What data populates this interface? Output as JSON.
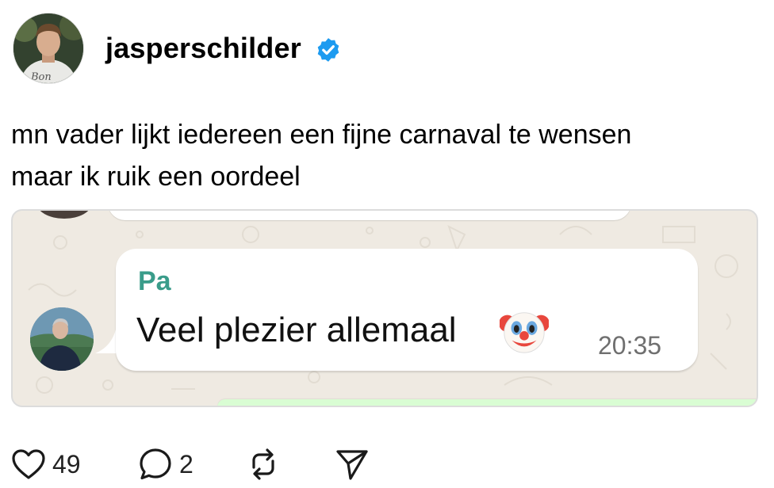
{
  "post": {
    "username": "jasperschilder",
    "verified": true,
    "text_lines": [
      "mn vader lijkt iedereen een fijne carnaval te wensen",
      "maar ik ruik een oordeel"
    ]
  },
  "embed": {
    "sender": "Pa",
    "message": "Veel plezier allemaal",
    "emoji": "clown-face",
    "time": "20:35"
  },
  "actions": {
    "likes": "49",
    "replies": "2"
  },
  "colors": {
    "verified": "#1d9bf0",
    "sender_name": "#3a9c8a",
    "chat_background": "#efeae2",
    "outgoing_bubble": "#d9fdd3"
  }
}
